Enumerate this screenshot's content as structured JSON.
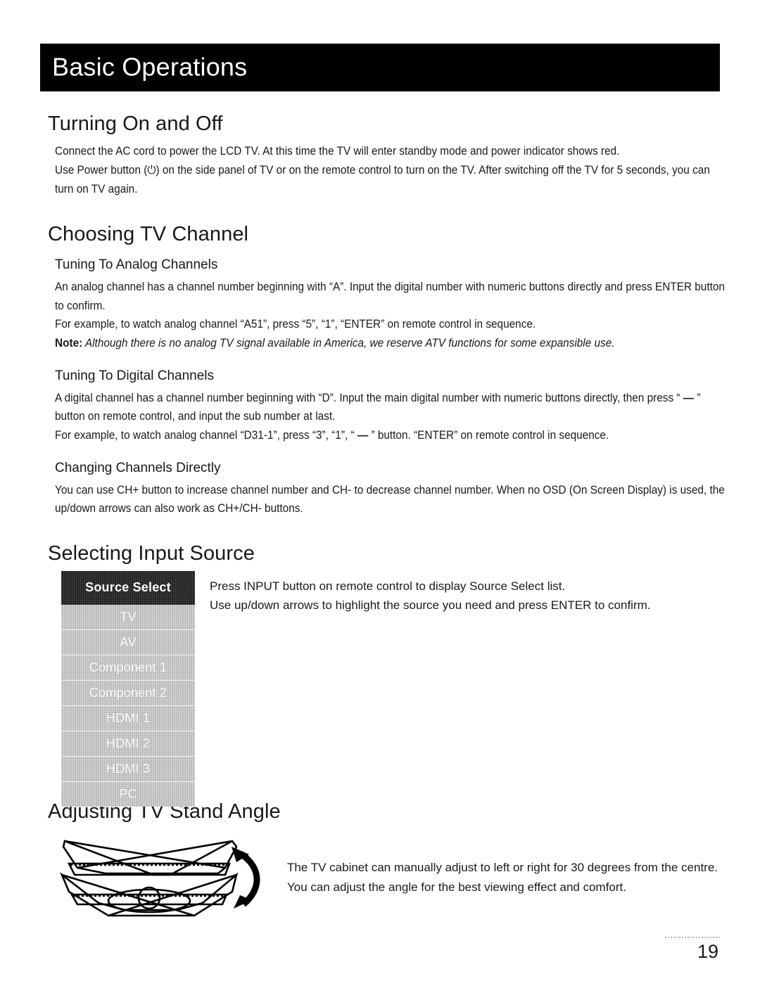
{
  "banner": {
    "title": "Basic Operations"
  },
  "sections": {
    "turning": {
      "heading": "Turning On and Off",
      "p1": "Connect the AC cord to power the LCD TV. At this time the TV will enter standby mode and power indicator shows red.",
      "p2_before": "Use Power button (",
      "p2_icon": "⏻",
      "p2_after": ") on the side panel of TV or on the remote control to turn on the TV. After switching off the TV for 5 seconds, you can turn on TV again."
    },
    "choosing": {
      "heading": "Choosing TV Channel",
      "analog": {
        "subheading": "Tuning To Analog Channels",
        "p1": "An analog channel has a channel number beginning with “A”. Input the digital number with numeric buttons directly and press ENTER button to confirm.",
        "p2": "For example, to watch analog channel “A51”, press “5”, “1”, “ENTER” on remote control in sequence.",
        "note_label": "Note:",
        "note_text": " Although there is no analog TV signal available in America, we reserve ATV functions for some expansible use."
      },
      "digital": {
        "subheading": "Tuning To Digital Channels",
        "p1_a": "A digital channel has a channel number beginning with “D”. Input the main digital number with numeric buttons directly, then press “ ",
        "p1_dash": "—",
        "p1_b": " ” button on remote control, and input the sub number at last.",
        "p2_a": "For example, to watch analog channel “D31-1”, press “3”, “1”, “ ",
        "p2_dash": "—",
        "p2_b": " ” button. “ENTER” on remote control in sequence."
      },
      "changing": {
        "subheading": "Changing Channels Directly",
        "p1": "You can use CH+ button to increase channel number and CH- to decrease channel number. When no OSD (On Screen Display) is used, the up/down arrows can also work as CH+/CH- buttons."
      }
    },
    "input_source": {
      "heading": "Selecting Input Source",
      "osd": {
        "title": "Source Select",
        "items": [
          "TV",
          "AV",
          "Component 1",
          "Component 2",
          "HDMI 1",
          "HDMI 2",
          "HDMI 3",
          "PC"
        ]
      },
      "p1": "Press INPUT button on remote control to display Source Select list.",
      "p2": "Use up/down arrows to highlight the source you need and press ENTER to confirm."
    },
    "stand": {
      "heading": "Adjusting TV Stand Angle",
      "p1": "The TV cabinet can manually adjust to left or right for 30 degrees from the centre.",
      "p2": "You can adjust the angle for the best viewing effect and comfort."
    }
  },
  "footer": {
    "page_number": "19"
  },
  "colors": {
    "banner_background": "#000000",
    "banner_text": "#ffffff",
    "osd_header_background": "#323232",
    "osd_item_background": "#c9c9c9",
    "osd_text": "#ffffff",
    "body_text": "#1a1a1a"
  }
}
